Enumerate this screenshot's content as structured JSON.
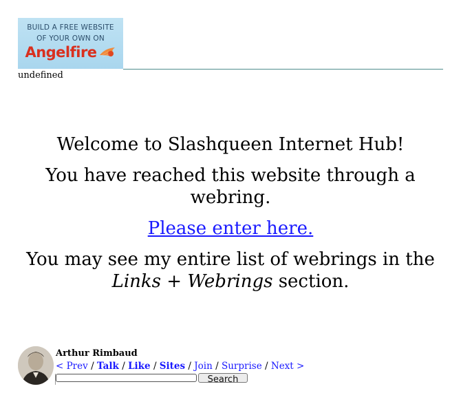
{
  "banner": {
    "line1": "BUILD A FREE WEBSITE",
    "line2": "OF YOUR OWN ON",
    "brand": "Angelfire",
    "logo_icon": "comet-icon",
    "bg_color": "#a9d6ee",
    "brand_color": "#d9301f"
  },
  "undefined_text": "undefined",
  "main": {
    "welcome": "Welcome to Slashqueen Internet Hub!",
    "reached": "You have reached this website through a webring.",
    "enter_link": "Please enter here.",
    "list_pre": "You may see my entire list of webrings in the",
    "list_em": "Links + Webrings",
    "list_post": "section."
  },
  "webring": {
    "title": "Arthur Rimbaud",
    "avatar_icon": "portrait-avatar",
    "prev": "< Prev",
    "talk": "Talk",
    "like": "Like",
    "sites": "Sites",
    "join": "Join",
    "surprise": "Surprise",
    "next": "Next >",
    "sep": "/",
    "search_value": "",
    "search_button": "Search",
    "link_color": "#1a1aff"
  }
}
